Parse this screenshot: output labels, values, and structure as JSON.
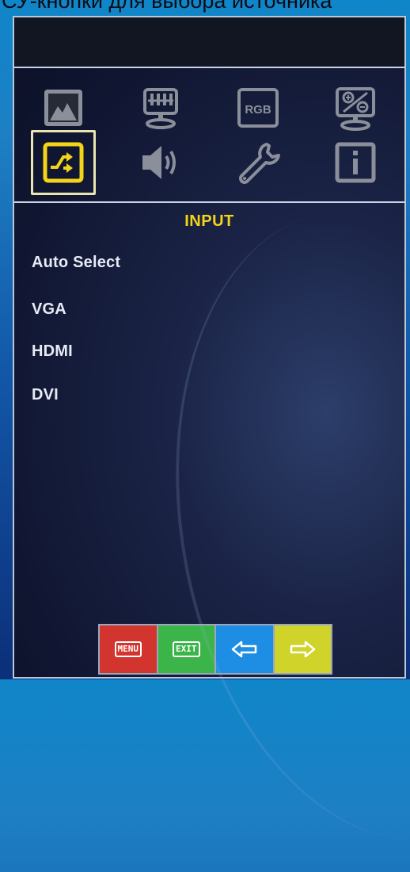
{
  "caption": "СУ-кнопки для выбора источника",
  "osd": {
    "title": "INPUT",
    "icons": {
      "row1": [
        "picture-icon",
        "display-settings-icon",
        "rgb-icon",
        "zoom-icon"
      ],
      "row2": [
        "input-source-icon",
        "speaker-icon",
        "wrench-icon",
        "info-icon"
      ],
      "rgb_label": "RGB",
      "selected": "input-source-icon"
    },
    "items": [
      "Auto Select",
      "VGA",
      "HDMI",
      "DVI"
    ],
    "buttons": {
      "menu_label": "MENU",
      "exit_label": "EXIT",
      "left_icon": "arrow-left-icon",
      "right_icon": "arrow-right-icon"
    },
    "colors": {
      "accent": "#f4d419",
      "menu_button": "#d2352e",
      "exit_button": "#3bb44a",
      "left_button": "#1d8ee3",
      "right_button": "#cfd32a",
      "icon_gray": "#8a8f99"
    }
  }
}
